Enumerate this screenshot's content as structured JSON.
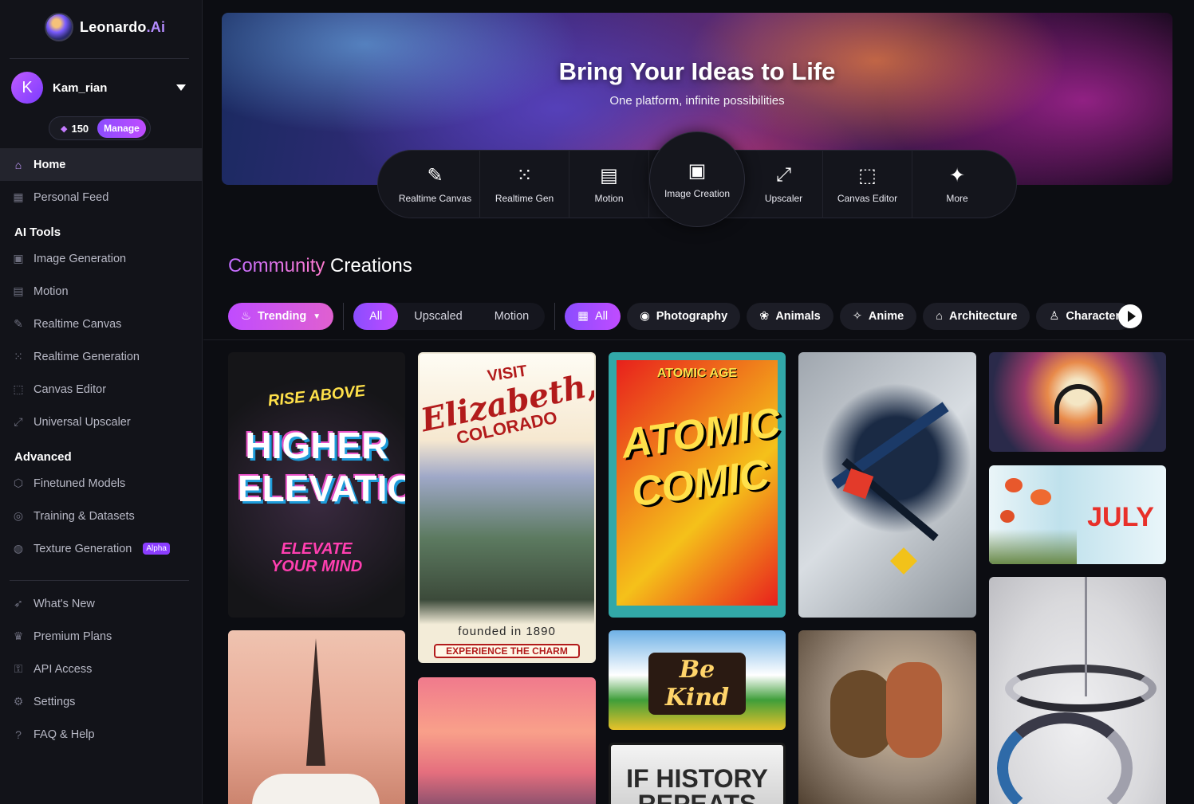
{
  "brand": {
    "name": "Leonardo",
    "suffix": ".Ai"
  },
  "user": {
    "initial": "K",
    "name": "Kam_rian"
  },
  "tokens": {
    "count": "150",
    "manage_label": "Manage"
  },
  "nav": {
    "main": [
      {
        "label": "Home",
        "icon": "home-icon"
      },
      {
        "label": "Personal Feed",
        "icon": "grid-icon"
      }
    ],
    "ai_tools_title": "AI Tools",
    "ai_tools": [
      {
        "label": "Image Generation",
        "icon": "image-icon"
      },
      {
        "label": "Motion",
        "icon": "film-icon"
      },
      {
        "label": "Realtime Canvas",
        "icon": "brush-icon"
      },
      {
        "label": "Realtime Generation",
        "icon": "dots-grid-icon"
      },
      {
        "label": "Canvas Editor",
        "icon": "crop-icon"
      },
      {
        "label": "Universal Upscaler",
        "icon": "upscale-icon"
      }
    ],
    "advanced_title": "Advanced",
    "advanced": [
      {
        "label": "Finetuned Models",
        "icon": "cube-icon"
      },
      {
        "label": "Training & Datasets",
        "icon": "dataset-icon"
      },
      {
        "label": "Texture Generation",
        "icon": "texture-icon",
        "badge": "Alpha"
      }
    ],
    "bottom": [
      {
        "label": "What's New",
        "icon": "rocket-icon"
      },
      {
        "label": "Premium Plans",
        "icon": "crown-icon"
      },
      {
        "label": "API Access",
        "icon": "key-icon"
      },
      {
        "label": "Settings",
        "icon": "gear-icon"
      },
      {
        "label": "FAQ & Help",
        "icon": "help-icon"
      }
    ]
  },
  "hero": {
    "title": "Bring Your Ideas to Life",
    "subtitle": "One platform, infinite possibilities"
  },
  "tools": [
    {
      "label": "Realtime Canvas",
      "icon": "brush-icon"
    },
    {
      "label": "Realtime Gen",
      "icon": "dots-grid-icon"
    },
    {
      "label": "Motion",
      "icon": "film-icon"
    },
    {
      "label": "Image Creation",
      "icon": "image-icon"
    },
    {
      "label": "Upscaler",
      "icon": "upscale-icon"
    },
    {
      "label": "Canvas Editor",
      "icon": "crop-icon"
    },
    {
      "label": "More",
      "icon": "sparkles-icon"
    }
  ],
  "community": {
    "accent": "Community",
    "rest": " Creations"
  },
  "filters": {
    "trending": "Trending",
    "types": [
      "All",
      "Upscaled",
      "Motion"
    ],
    "categories": [
      "All",
      "Photography",
      "Animals",
      "Anime",
      "Architecture",
      "Character"
    ]
  },
  "gallery_text": {
    "higher_top": "RISE ABOVE",
    "higher_main": "HIGHER ELEVATION",
    "higher_bottom": "ELEVATE YOUR MIND",
    "eliz_visit": "VISIT",
    "eliz_name": "Elizabeth,",
    "eliz_state": "COLORADO",
    "eliz_founded": "founded in 1890",
    "eliz_tag": "EXPERIENCE THE CHARM",
    "comic_top": "ATOMIC AGE",
    "comic_main": "ATOMIC COMIC",
    "bekind": "Be Kind",
    "history": "IF HISTORY REPEATS ITSELF",
    "july": "JULY"
  }
}
